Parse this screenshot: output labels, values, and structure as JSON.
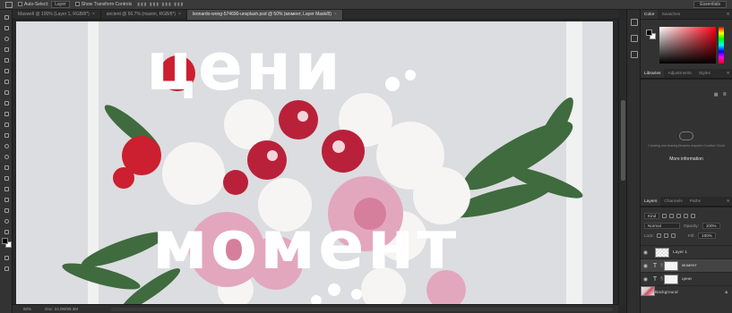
{
  "options_bar": {
    "auto_select_label": "Auto-Select:",
    "auto_select_value": "Layer",
    "show_transform_label": "Show Transform Controls",
    "workspace": "Essentials"
  },
  "doc_tabs": [
    {
      "label": "Maxwell @ 100% (Layer 1, RGB/8*)",
      "active": false
    },
    {
      "label": "ancient @ 66.7% (maxim, RGB/8*)",
      "active": false
    },
    {
      "label": "leonardo-wong-574690-unsplash.psd @ 50% (момент, Layer Mask/8)",
      "active": true
    }
  ],
  "canvas": {
    "line1": "цени",
    "line2": "момент"
  },
  "status_bar": {
    "zoom": "50%",
    "doc_info": "Doc: 24.0M/69.3M"
  },
  "color_panel": {
    "tabs": [
      "Color",
      "Swatches"
    ],
    "fg": "#000000",
    "bg": "#ffffff",
    "hue": "#ff0015"
  },
  "libraries_panel": {
    "tabs": [
      "Libraries",
      "Adjustments",
      "Styles"
    ],
    "message": "Creating and sharing libraries requires Creative Cloud",
    "more_info": "More information"
  },
  "layers_panel": {
    "tabs": [
      "Layers",
      "Channels",
      "Paths"
    ],
    "filter_kind": "Kind",
    "blend_mode": "Normal",
    "opacity_label": "Opacity:",
    "opacity": "100%",
    "lock_label": "Lock:",
    "fill_label": "Fill:",
    "fill": "100%",
    "layers": [
      {
        "name": "Layer 1",
        "kind": "pixel",
        "selected": false
      },
      {
        "name": "момент",
        "kind": "text",
        "selected": true
      },
      {
        "name": "цени",
        "kind": "text",
        "selected": false
      },
      {
        "name": "Background",
        "kind": "photo",
        "selected": false,
        "locked": true
      }
    ]
  }
}
